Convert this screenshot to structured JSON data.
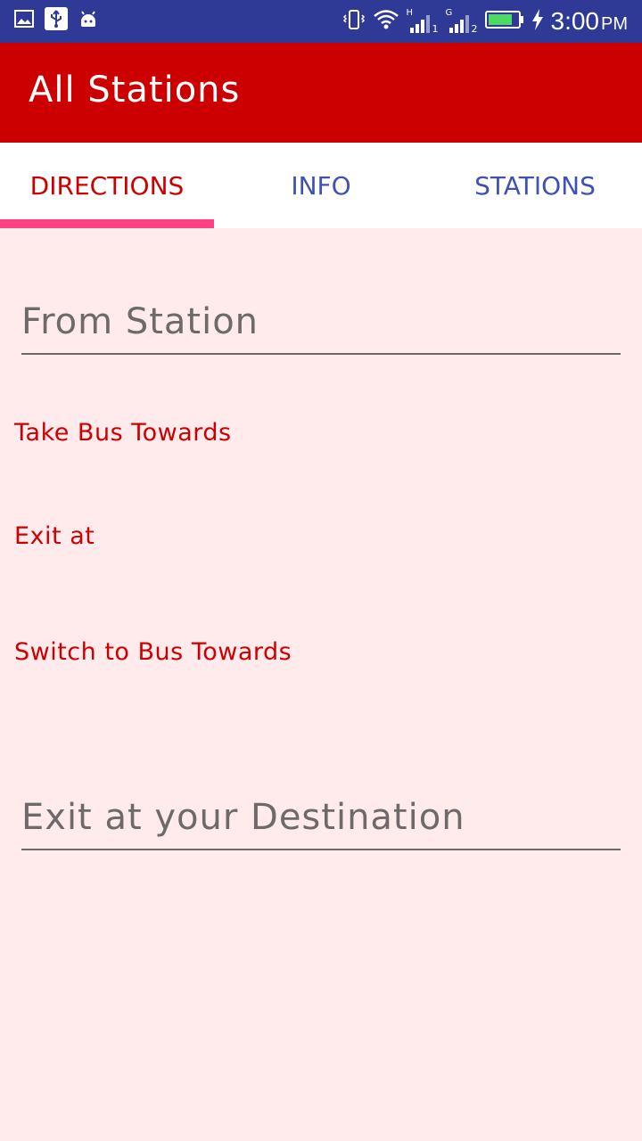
{
  "status_bar": {
    "icons_left": [
      "image-icon",
      "usb-icon",
      "android-icon"
    ],
    "icons_right": [
      "vibrate-icon",
      "wifi-icon",
      "signal-1-icon",
      "signal-2-icon",
      "battery-icon",
      "charging-icon"
    ],
    "sim1_label": "H",
    "sim1_index": "1",
    "sim2_label": "G",
    "sim2_index": "2",
    "time": "3:00",
    "ampm": "PM"
  },
  "app_bar": {
    "title": "All Stations"
  },
  "tabs": [
    {
      "label": "DIRECTIONS",
      "active": true
    },
    {
      "label": "INFO",
      "active": false
    },
    {
      "label": "STATIONS",
      "active": false
    }
  ],
  "form": {
    "from_placeholder": "From Station",
    "take_bus_label": "Take Bus Towards",
    "exit_at_label": "Exit at",
    "switch_label": "Switch to Bus Towards",
    "destination_placeholder": "Exit at your Destination"
  },
  "colors": {
    "status_bar": "#2e3a95",
    "app_bar": "#cc0000",
    "tab_active": "#cc0000",
    "tab_inactive": "#3f51b5",
    "tab_indicator": "#ff4081",
    "background": "#ffeaec"
  }
}
